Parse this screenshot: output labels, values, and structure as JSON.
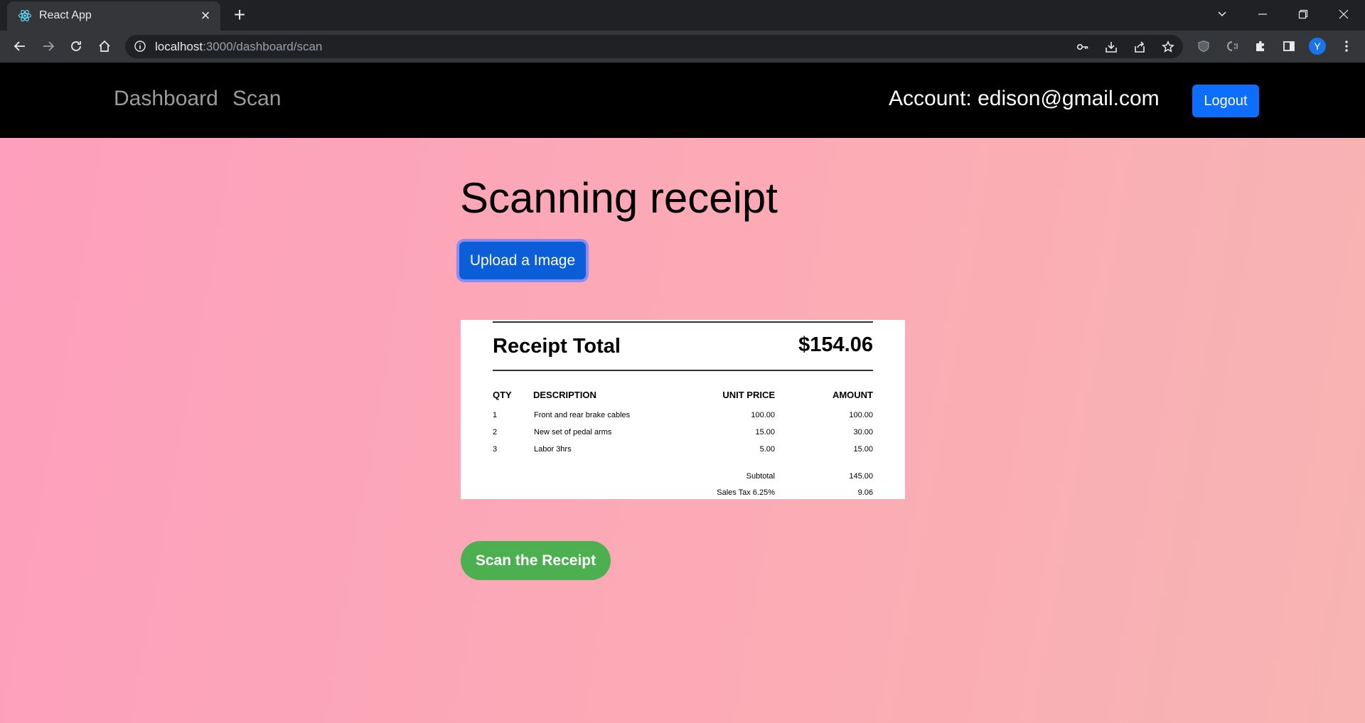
{
  "browser": {
    "tab_title": "React App",
    "url_host": "localhost",
    "url_path": ":3000/dashboard/scan",
    "profile_initial": "Y"
  },
  "nav": {
    "dashboard_label": "Dashboard",
    "scan_label": "Scan",
    "account_text": "Account: edison@gmail.com",
    "logout_label": "Logout"
  },
  "main": {
    "heading": "Scanning receipt",
    "upload_label": "Upload a Image",
    "scan_label": "Scan the Receipt"
  },
  "receipt": {
    "title": "Receipt Total",
    "total": "$154.06",
    "headers": [
      "QTY",
      "DESCRIPTION",
      "UNIT PRICE",
      "AMOUNT"
    ],
    "rows": [
      {
        "qty": "1",
        "description": "Front and rear brake cables",
        "unit_price": "100.00",
        "amount": "100.00"
      },
      {
        "qty": "2",
        "description": "New set of pedal arms",
        "unit_price": "15.00",
        "amount": "30.00"
      },
      {
        "qty": "3",
        "description": "Labor 3hrs",
        "unit_price": "5.00",
        "amount": "15.00"
      }
    ],
    "subtotal_label": "Subtotal",
    "subtotal": "145.00",
    "tax_label": "Sales Tax 6.25%",
    "tax": "9.06"
  },
  "colors": {
    "upload_button": "#0b5ed7",
    "scan_button": "#4caf50",
    "logout_button": "#0d6efd",
    "navbar": "#000000",
    "page_gradient_start": "#fd9fbd",
    "page_gradient_end": "#f7b4b2"
  }
}
